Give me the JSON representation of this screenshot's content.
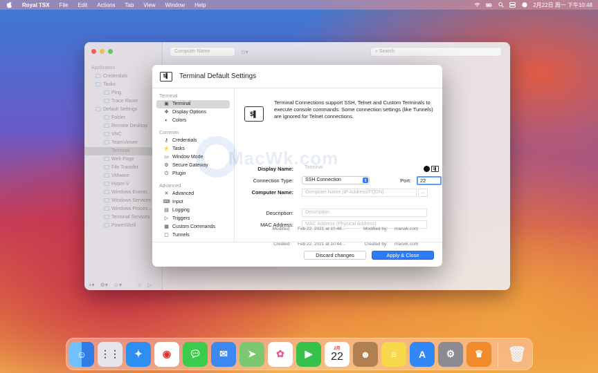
{
  "menubar": {
    "app_name": "Royal TSX",
    "items": [
      "File",
      "Edit",
      "Actions",
      "Tab",
      "View",
      "Window",
      "Help"
    ],
    "clock": "2月22日 周一 下午10:48"
  },
  "background_window": {
    "connection_placeholder": "Computer Name",
    "search_placeholder": "Search",
    "tree": [
      {
        "label": "Application",
        "level": 0,
        "type": "header"
      },
      {
        "label": "Credentials",
        "level": 1
      },
      {
        "label": "Tasks",
        "level": 1
      },
      {
        "label": "Ping",
        "level": 2
      },
      {
        "label": "Trace Route",
        "level": 2
      },
      {
        "label": "Default Settings",
        "level": 1
      },
      {
        "label": "Folder",
        "level": 2
      },
      {
        "label": "Remote Desktop",
        "level": 2
      },
      {
        "label": "VNC",
        "level": 2
      },
      {
        "label": "TeamViewer",
        "level": 2
      },
      {
        "label": "Terminal",
        "level": 2,
        "selected": true
      },
      {
        "label": "Web Page",
        "level": 2
      },
      {
        "label": "File Transfer",
        "level": 2
      },
      {
        "label": "VMware",
        "level": 2
      },
      {
        "label": "Hyper-V",
        "level": 2
      },
      {
        "label": "Windows Events...",
        "level": 2
      },
      {
        "label": "Windows Services",
        "level": 2
      },
      {
        "label": "Windows Proces...",
        "level": 2
      },
      {
        "label": "Terminal Services",
        "level": 2
      },
      {
        "label": "PowerShell",
        "level": 2
      }
    ]
  },
  "dialog": {
    "title": "Terminal Default Settings",
    "sidebar": {
      "group_terminal": "Terminal",
      "terminal_items": [
        "Terminal",
        "Display Options",
        "Colors"
      ],
      "group_common": "Common",
      "common_items": [
        "Credentials",
        "Tasks",
        "Window Mode",
        "Secure Gateway",
        "Plugin"
      ],
      "group_advanced": "Advanced",
      "advanced_items": [
        "Advanced",
        "Input",
        "Logging",
        "Triggers",
        "Custom Commands",
        "Tunnels"
      ]
    },
    "info_text": "Terminal Connections support SSH, Telnet and Custom Terminals to execute console commands. Some connection settings (like Tunnels) are ignored for Telnet connections.",
    "fields": {
      "display_name_label": "Display Name:",
      "display_name_placeholder": "Terminal",
      "connection_type_label": "Connection Type:",
      "connection_type_value": "SSH Connection",
      "port_label": "Port:",
      "port_value": "22",
      "computer_name_label": "Computer Name:",
      "computer_name_placeholder": "Computer Name (IP Address/FQDN)",
      "browse_label": "...",
      "description_label": "Description:",
      "description_placeholder": "Description",
      "mac_label": "MAC Address:",
      "mac_placeholder": "MAC Address (Physical Address)"
    },
    "meta": {
      "created_label": "Created:",
      "created_value": "Feb 22, 2021 at 10:44...",
      "created_by_label": "Created by:",
      "created_by_value": "macwk.com",
      "modified_label": "Modified:",
      "modified_value": "Feb 22, 2021 at 10:46...",
      "modified_by_label": "Modified by:",
      "modified_by_value": "macwk.com"
    },
    "buttons": {
      "discard": "Discard changes",
      "apply": "Apply & Close"
    }
  },
  "watermark": "MacWk.com",
  "dock": {
    "apps": [
      {
        "icon": "finder-icon",
        "color": "#3a8ef0"
      },
      {
        "icon": "launchpad-icon",
        "color": "#e8e8ec"
      },
      {
        "icon": "safari-icon",
        "color": "#2f8ff0"
      },
      {
        "icon": "chrome-icon",
        "color": "#ffffff"
      },
      {
        "icon": "messages-icon",
        "color": "#3ccc4c"
      },
      {
        "icon": "mail-icon",
        "color": "#3a88f0"
      },
      {
        "icon": "maps-icon",
        "color": "#7cc870"
      },
      {
        "icon": "photos-icon",
        "color": "#ffffff"
      },
      {
        "icon": "facetime-icon",
        "color": "#36c24a"
      },
      {
        "icon": "calendar-icon",
        "color": "#ffffff",
        "month": "2月",
        "day": "22"
      },
      {
        "icon": "contacts-icon",
        "color": "#b08050"
      },
      {
        "icon": "notes-icon",
        "color": "#f7d84a"
      },
      {
        "icon": "app-store-icon",
        "color": "#2f88f5"
      },
      {
        "icon": "system-preferences-icon",
        "color": "#8a8a90"
      },
      {
        "icon": "royal-tsx-icon",
        "color": "#f08a2a"
      }
    ],
    "trash_icon": "trash-icon"
  }
}
